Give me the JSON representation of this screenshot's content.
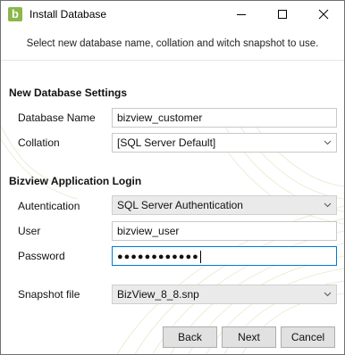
{
  "window": {
    "title": "Install Database",
    "icon_letter": "b",
    "controls": [
      "minimize-icon",
      "maximize-icon",
      "close-icon"
    ]
  },
  "subtitle": "Select new database name, collation and witch snapshot to use.",
  "sections": {
    "new_db": {
      "title": "New Database Settings",
      "database_name_label": "Database Name",
      "database_name_value": "bizview_customer",
      "collation_label": "Collation",
      "collation_value": "[SQL Server Default]"
    },
    "login": {
      "title": "Bizview Application Login",
      "authentication_label": "Autentication",
      "authentication_value": "SQL Server Authentication",
      "user_label": "User",
      "user_value": "bizview_user",
      "password_label": "Password",
      "password_masked": "●●●●●●●●●●●●"
    }
  },
  "snapshot": {
    "label": "Snapshot file",
    "value": "BizView_8_8.snp"
  },
  "buttons": {
    "back": "Back",
    "next": "Next",
    "cancel": "Cancel"
  },
  "colors": {
    "accent": "#0078d7",
    "brand": "#8cb74a",
    "deco": "#e3ecd0"
  }
}
